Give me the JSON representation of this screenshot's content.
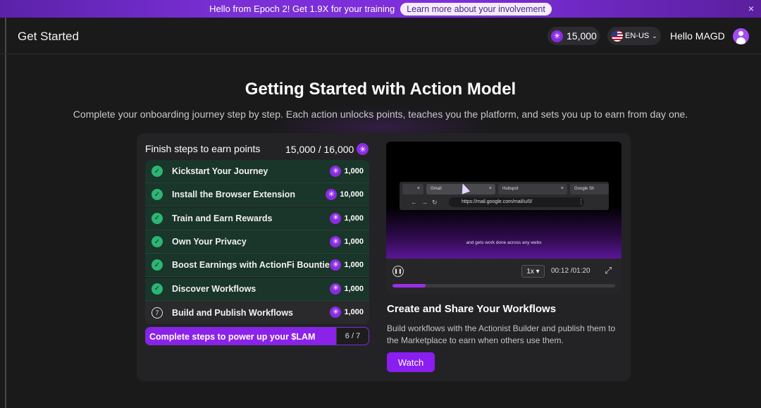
{
  "banner": {
    "text": "Hello from Epoch 2! Get 1.9X for your training",
    "link_label": "Learn more about your involvement",
    "close_symbol": "×"
  },
  "header": {
    "title": "Get Started",
    "points": "15,000",
    "language": "EN-US",
    "greeting": "Hello MAGD"
  },
  "hero": {
    "title": "Getting Started with Action Model",
    "subtitle": "Complete your onboarding journey step by step. Each action unlocks points, teaches you the platform, and sets you up to earn from day one."
  },
  "steps_panel": {
    "heading": "Finish steps to earn points",
    "total": "15,000 / 16,000",
    "steps": [
      {
        "label": "Kickstart Your Journey",
        "points": "1,000",
        "status": "done"
      },
      {
        "label": "Install the Browser Extension",
        "points": "10,000",
        "status": "done"
      },
      {
        "label": "Train and Earn Rewards",
        "points": "1,000",
        "status": "done"
      },
      {
        "label": "Own Your Privacy",
        "points": "1,000",
        "status": "done"
      },
      {
        "label": "Boost Earnings with ActionFi Bounties",
        "points": "1,000",
        "status": "done"
      },
      {
        "label": "Discover Workflows",
        "points": "1,000",
        "status": "done"
      },
      {
        "label": "Build and Publish Workflows",
        "points": "1,000",
        "status": "pending",
        "number": "7"
      }
    ],
    "progress": {
      "label": "Complete steps to power up your $LAM",
      "count": "6 / 7",
      "fraction": 0.857
    }
  },
  "video": {
    "tabs": [
      "Gmail",
      "Hubspot",
      "Google Sh"
    ],
    "url": "https://mail.google.com/mail/u/0/",
    "caption": "and gets work done across any webs",
    "speed": "1x",
    "time": "00:12 /01:20",
    "progress_fraction": 0.15
  },
  "workflow": {
    "title": "Create and Share Your Workflows",
    "description": "Build workflows with the Actionist Builder and publish them to the Marketplace to earn when others use them.",
    "watch_label": "Watch"
  },
  "colors": {
    "accent": "#8a1ef0",
    "done_row": "#1a3529",
    "check": "#2bb673",
    "background": "#1a1a1b"
  },
  "icons": {
    "points": "lam-token-icon",
    "check": "check-circle-icon",
    "close": "close-icon"
  }
}
